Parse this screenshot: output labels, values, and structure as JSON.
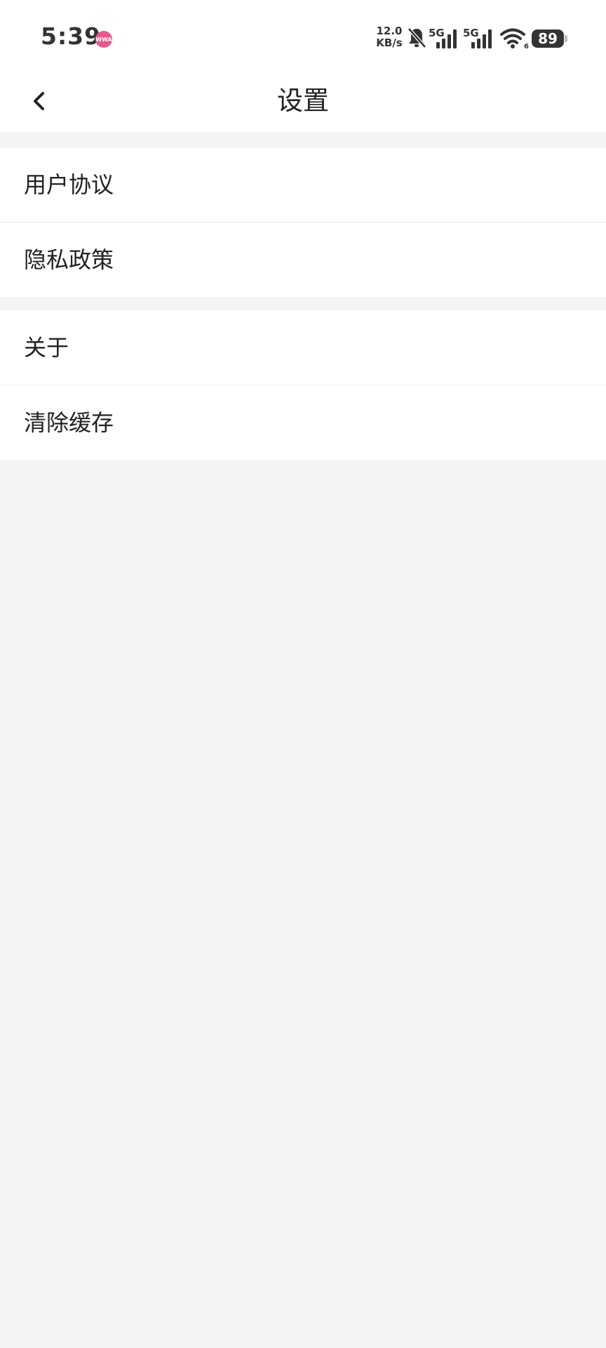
{
  "status_bar": {
    "time": "5:39",
    "app_badge": "WWA",
    "net_speed_value": "12.0",
    "net_speed_unit": "KB/s",
    "sim1_label": "5G",
    "sim2_label": "5G",
    "wifi_label": "6",
    "battery": "89",
    "icons": [
      "bell-muted-icon",
      "signal-icon",
      "signal-icon",
      "wifi-icon",
      "battery-icon"
    ]
  },
  "nav": {
    "title": "设置",
    "back_icon": "chevron-left-icon"
  },
  "groups": [
    {
      "items": [
        {
          "label": "用户协议"
        },
        {
          "label": "隐私政策"
        }
      ]
    },
    {
      "items": [
        {
          "label": "关于"
        },
        {
          "label": "清除缓存"
        }
      ]
    }
  ],
  "colors": {
    "page_background": "#f4f4f4",
    "surface": "#ffffff",
    "text_primary": "#222222",
    "divider": "#ececec",
    "badge_pink": "#e9578e"
  }
}
